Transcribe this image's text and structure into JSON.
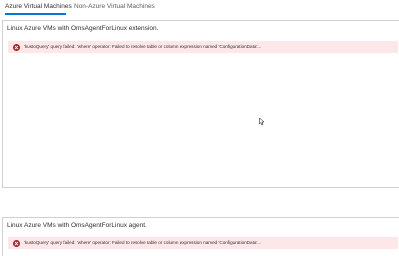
{
  "tabs": [
    {
      "label": "Azure Virtual Machines",
      "active": true
    },
    {
      "label": "Non-Azure Virtual Machines",
      "active": false
    }
  ],
  "panels": [
    {
      "title": "Linux Azure VMs with OmsAgentForLinux extension.",
      "error": "'kustoQuery' query failed: 'where' operator: Failed to resolve table or column expression named 'ConfigurationData'..."
    },
    {
      "title": "Linux Azure VMs with OmsAgentForLinux agent.",
      "error": "'kustoQuery' query failed: 'where' operator: Failed to resolve table or column expression named 'ConfigurationData'..."
    }
  ],
  "colors": {
    "accent": "#0078d4",
    "error_bg": "#fde7e9",
    "error_icon": "#a4262c"
  },
  "icons": {
    "error": "error-circle-icon",
    "cursor": "mouse-cursor-icon"
  }
}
